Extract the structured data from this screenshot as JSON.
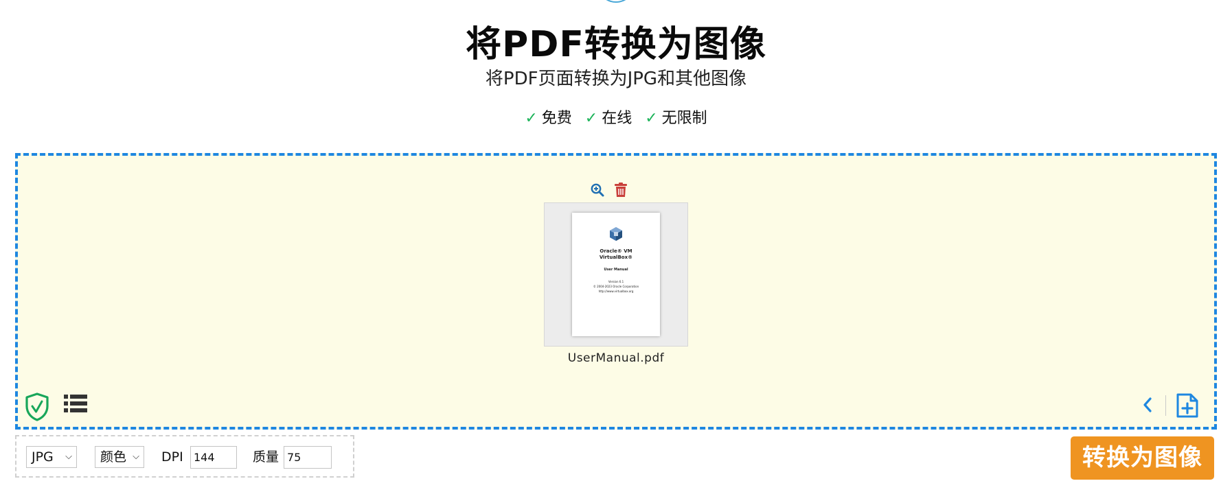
{
  "header": {
    "title": "将PDF转换为图像",
    "subtitle": "将PDF页面转换为JPG和其他图像",
    "features": [
      {
        "check": "✓",
        "label": "免费"
      },
      {
        "check": "✓",
        "label": "在线"
      },
      {
        "check": "✓",
        "label": "无限制"
      }
    ]
  },
  "file": {
    "name": "UserManual.pdf",
    "thumbnail": {
      "line1": "Oracle® VM",
      "line2": "VirtualBox®",
      "line3": "User Manual",
      "line4": "Version 6.1",
      "line5": "© 2004-2023 Oracle Corporation",
      "line6": "http://www.virtualbox.org"
    }
  },
  "options": {
    "format": "JPG",
    "color": "颜色",
    "dpi_label": "DPI",
    "dpi_value": "144",
    "quality_label": "质量",
    "quality_value": "75"
  },
  "actions": {
    "convert_label": "转换为图像"
  },
  "colors": {
    "accent_blue": "#1e87e0",
    "drop_bg": "#fdfce6",
    "convert_orange": "#ef9421",
    "check_green": "#1db45a",
    "delete_red": "#c9403a"
  }
}
